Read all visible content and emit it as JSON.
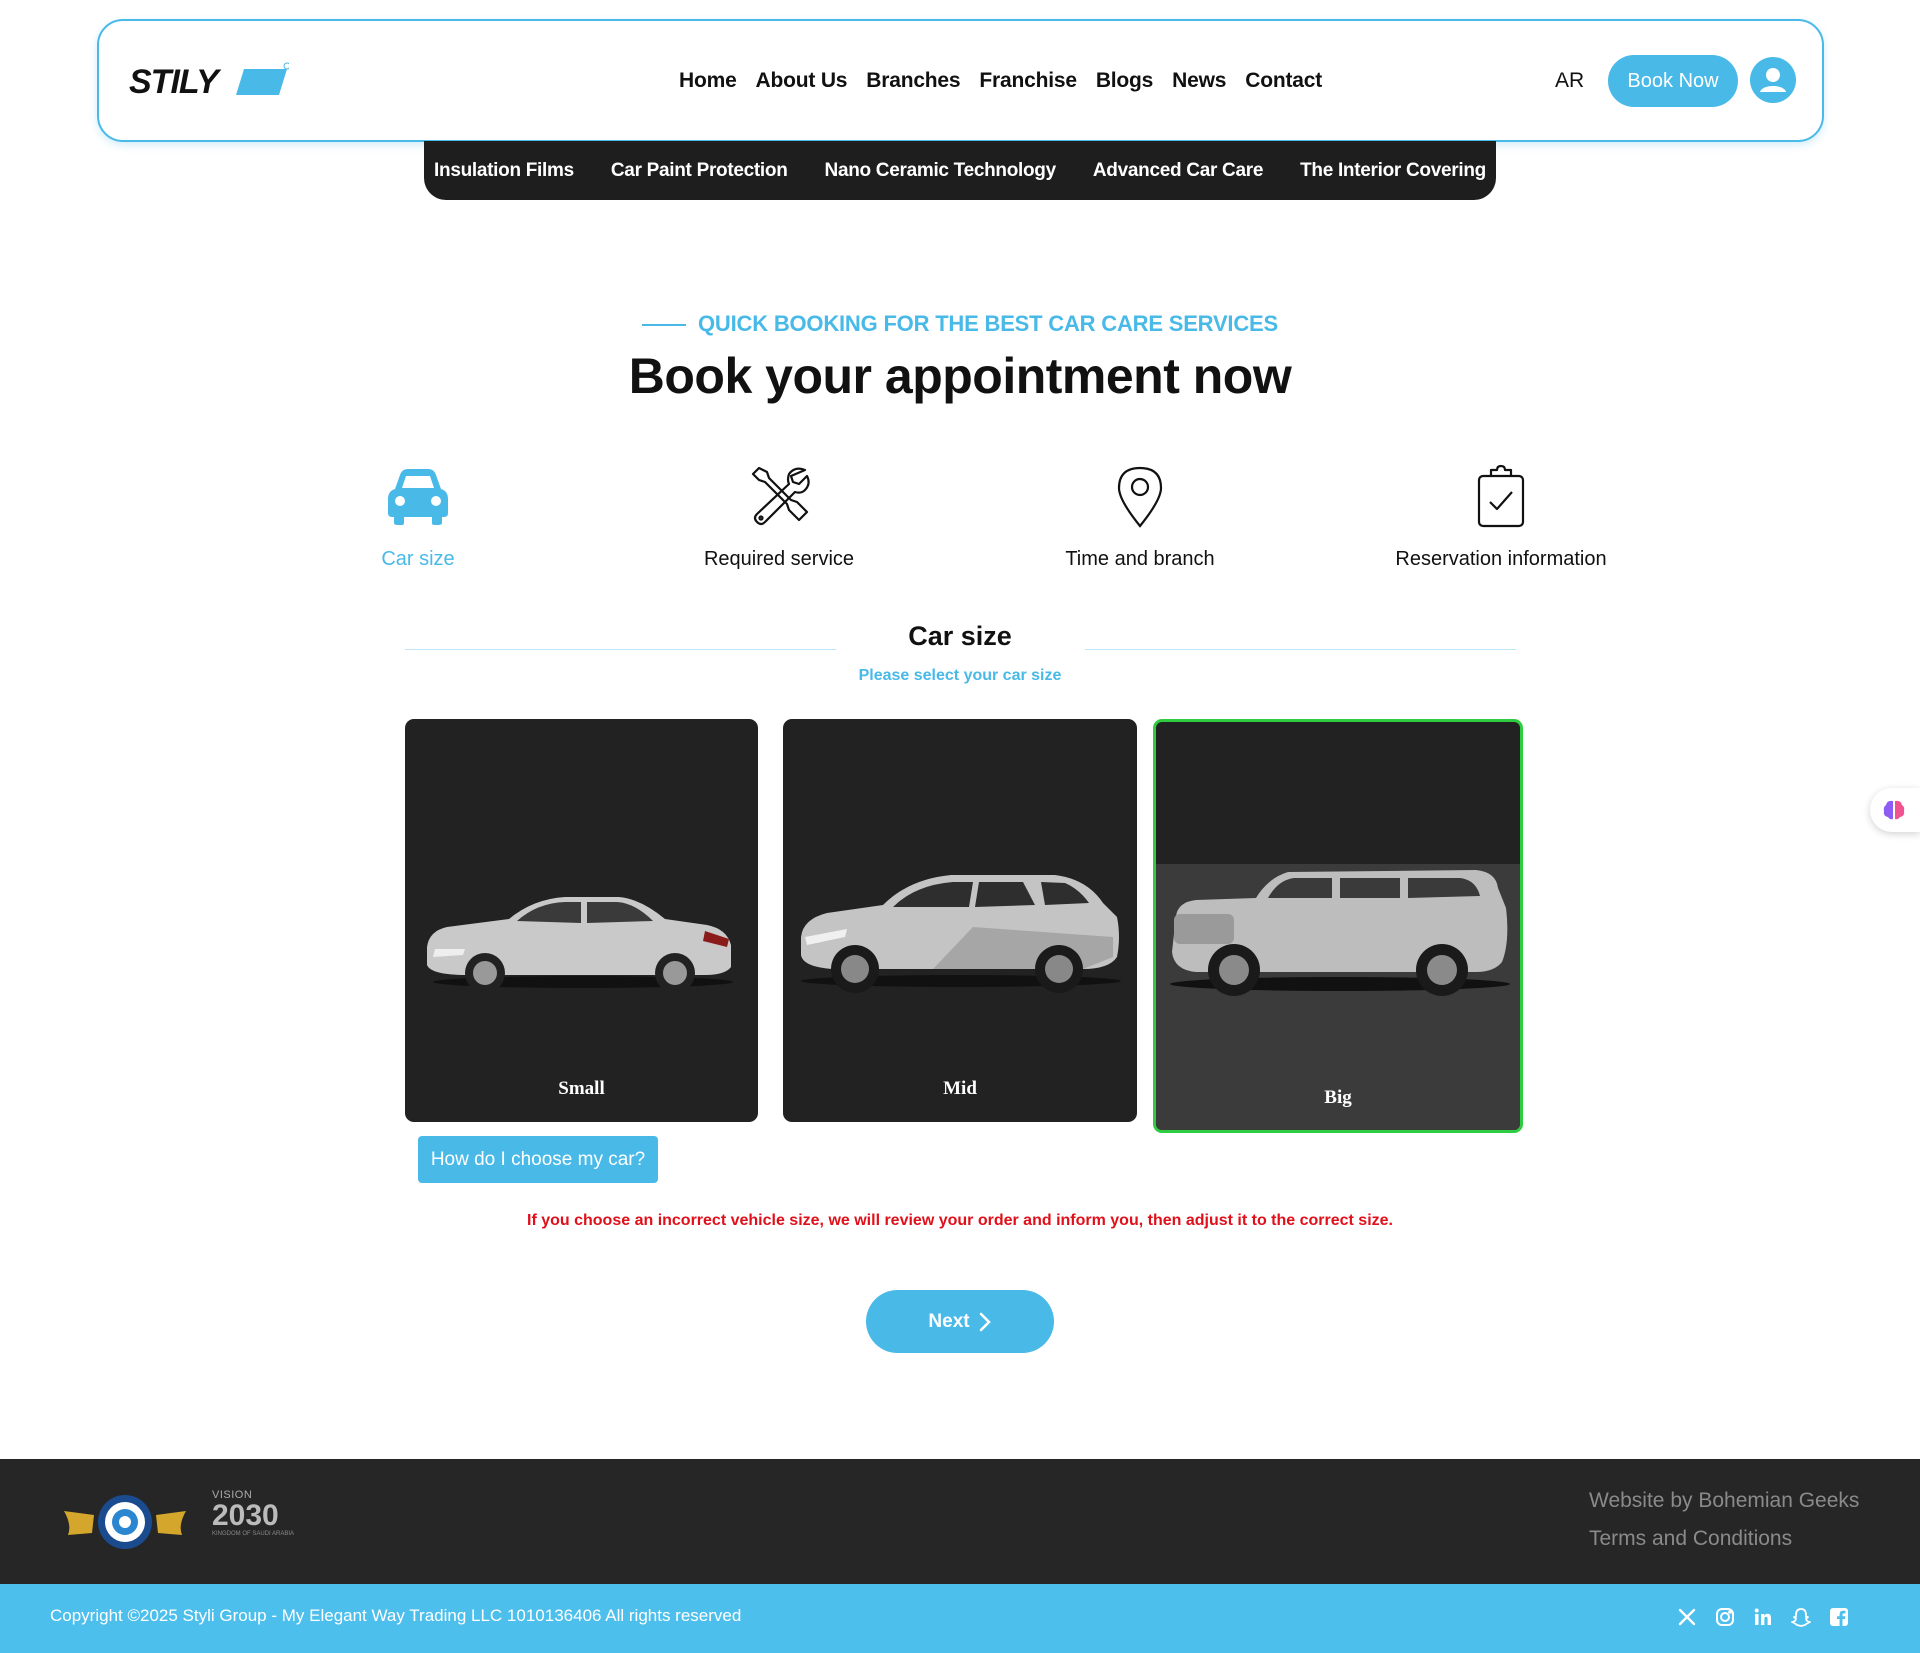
{
  "brand": {
    "logo_text": "STILY"
  },
  "nav": {
    "items": [
      "Home",
      "About Us",
      "Branches",
      "Franchise",
      "Blogs",
      "News",
      "Contact"
    ],
    "lang": "AR",
    "book_now": "Book Now"
  },
  "subnav": {
    "items": [
      "Insulation Films",
      "Car Paint Protection",
      "Nano Ceramic Technology",
      "Advanced Car Care",
      "The Interior Covering"
    ]
  },
  "hero": {
    "eyebrow": "QUICK BOOKING FOR THE BEST CAR CARE SERVICES",
    "title": "Book your appointment now"
  },
  "steps": [
    {
      "label": "Car size",
      "icon": "car-icon",
      "active": true
    },
    {
      "label": "Required service",
      "icon": "tools-icon",
      "active": false
    },
    {
      "label": "Time and branch",
      "icon": "location-pin-icon",
      "active": false
    },
    {
      "label": "Reservation information",
      "icon": "clipboard-check-icon",
      "active": false
    }
  ],
  "section": {
    "title": "Car size",
    "subtitle": "Please select your car size"
  },
  "cars": [
    {
      "name": "Small",
      "selected": false
    },
    {
      "name": "Mid",
      "selected": false
    },
    {
      "name": "Big",
      "selected": true
    }
  ],
  "help_button": "How do I choose my car?",
  "warning": "If you choose an incorrect vehicle size, we will review your order and inform you, then adjust it to the correct size.",
  "next_button": "Next",
  "footer": {
    "vision_text": "VISION",
    "vision_year": "2030",
    "vision_sub": "KINGDOM OF SAUDI ARABIA",
    "links": [
      "Website by Bohemian Geeks",
      "Terms and Conditions"
    ],
    "copyright": "Copyright ©2025 Styli Group - My Elegant Way Trading LLC 1010136406 All rights reserved",
    "social": [
      "x-icon",
      "instagram-icon",
      "linkedin-icon",
      "snapchat-icon",
      "facebook-icon"
    ]
  },
  "colors": {
    "accent": "#49b9e8",
    "dark": "#222222",
    "warning": "#e0101a",
    "selected_border": "#2ecc40"
  }
}
